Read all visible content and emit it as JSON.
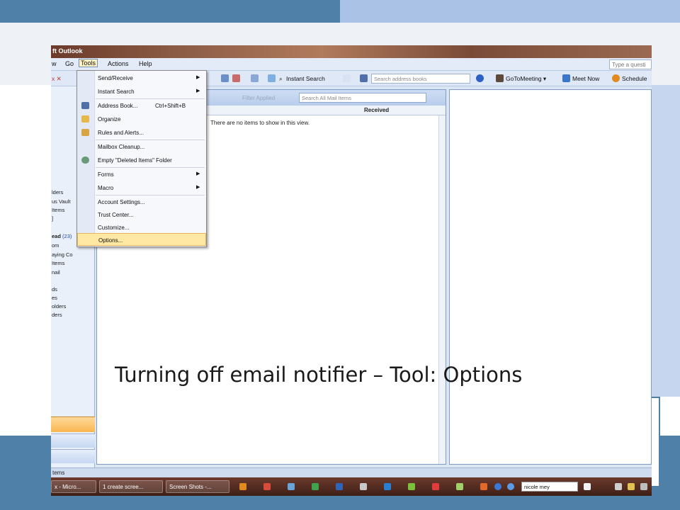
{
  "window": {
    "title": "ft Outlook"
  },
  "menu": {
    "go": "Go",
    "tools": "Tools",
    "actions": "Actions",
    "help": "Help",
    "help_placeholder": "Type a questi"
  },
  "toolbar": {
    "instant_search": "Instant Search",
    "address_placeholder": "Search address books",
    "gotomeeting": "GoToMeeting ▾",
    "meet_now": "Meet Now",
    "schedule": "Schedule"
  },
  "nav": {
    "items": [
      {
        "text": "lders"
      },
      {
        "text": "us Vault"
      },
      {
        "text": "Items"
      },
      {
        "text": "]"
      }
    ],
    "unread_label": "ead",
    "unread_count": "(23)",
    "items2": [
      {
        "text": "om"
      },
      {
        "text": "aying Co"
      },
      {
        "text": "Items"
      },
      {
        "text": "nail"
      },
      {
        "text": "ds"
      },
      {
        "text": "es"
      },
      {
        "text": "olders"
      },
      {
        "text": "ders"
      }
    ]
  },
  "list": {
    "filter_applied": "Filter Applied",
    "search_placeholder": "Search All Mail Items",
    "received_header": "Received",
    "empty_message": "There are no items to show in this view."
  },
  "status": {
    "text": "tems"
  },
  "taskbar": {
    "buttons": [
      "x - Micro...",
      "1 create scree...",
      "Screen Shots -..."
    ],
    "user_box": "nicole mey"
  },
  "tools_menu": {
    "items": [
      {
        "label": "Send/Receive",
        "submenu": true
      },
      {
        "label": "Instant Search",
        "submenu": true
      },
      {
        "label": "Address Book...",
        "shortcut": "Ctrl+Shift+B"
      },
      {
        "label": "Organize"
      },
      {
        "label": "Rules and Alerts..."
      },
      {
        "label": "Mailbox Cleanup..."
      },
      {
        "label": "Empty \"Deleted Items\" Folder"
      },
      {
        "label": "Forms",
        "submenu": true
      },
      {
        "label": "Macro",
        "submenu": true
      },
      {
        "label": "Account Settings..."
      },
      {
        "label": "Trust Center..."
      },
      {
        "label": "Customize..."
      },
      {
        "label": "Options...",
        "highlighted": true
      }
    ]
  },
  "caption": "Turning off email notifier – Tool: Options",
  "colors": {
    "slide_blue": "#4f81a8",
    "slide_light_blue": "#a9c2e6",
    "menu_highlight": "#ffe8a3"
  }
}
